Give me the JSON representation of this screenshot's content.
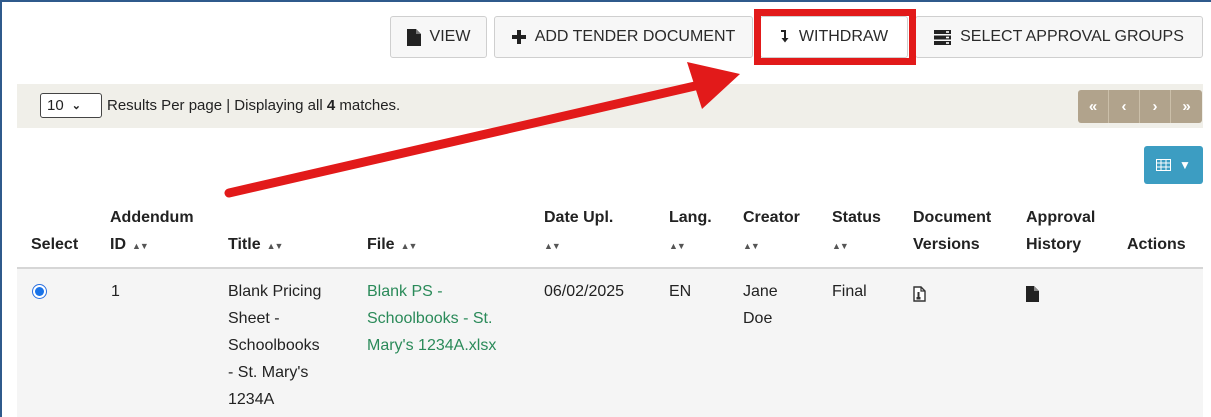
{
  "toolbar": {
    "view_label": "VIEW",
    "add_label": "ADD TENDER DOCUMENT",
    "withdraw_label": "WITHDRAW",
    "approval_label": "SELECT APPROVAL GROUPS"
  },
  "results": {
    "per_page_value": "10",
    "text_prefix": "Results Per page | Displaying all ",
    "match_count": "4",
    "text_suffix": " matches."
  },
  "pager": [
    "«",
    "‹",
    "›",
    "»"
  ],
  "columns": {
    "select": "Select",
    "addendum_line1": "Addendum",
    "addendum_line2": "ID",
    "title": "Title",
    "file": "File",
    "date_line1": "Date Upl.",
    "lang_line1": "Lang.",
    "creator_line1": "Creator",
    "status_line1": "Status",
    "docver_line1": "Document",
    "docver_line2": "Versions",
    "approval_line1": "Approval",
    "approval_line2": "History",
    "actions": "Actions"
  },
  "rows": [
    {
      "addendum_id": "1",
      "title_lines": [
        "Blank Pricing",
        "Sheet -",
        "Schoolbooks",
        "- St. Mary's",
        "1234A"
      ],
      "file_lines": [
        "Blank PS -",
        "Schoolbooks - St.",
        "Mary's 1234A.xlsx"
      ],
      "date": "06/02/2025",
      "lang": "EN",
      "creator_lines": [
        "Jane",
        "Doe"
      ],
      "status": "Final",
      "document_versions_icon": "file-versions-icon",
      "approval_history_icon": "file-icon"
    }
  ],
  "colors": {
    "highlight": "#e21a1a",
    "pager": "#b1a38c",
    "column_button": "#3c9dc2",
    "file_link": "#2a8a59"
  }
}
